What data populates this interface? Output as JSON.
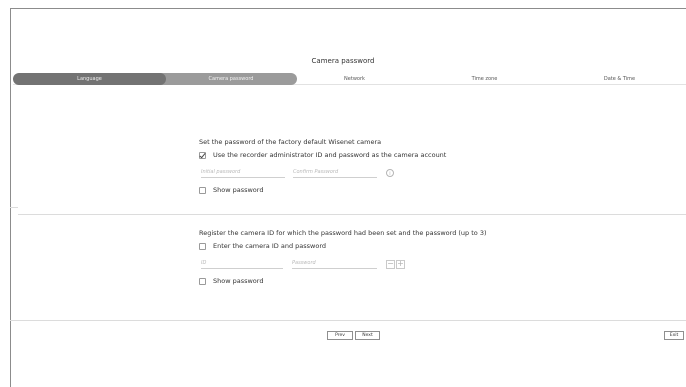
{
  "header": {
    "title": "Camera password"
  },
  "steps": [
    {
      "label": "Language",
      "state": "done"
    },
    {
      "label": "Camera password",
      "state": "active"
    },
    {
      "label": "Network",
      "state": "pending"
    },
    {
      "label": "Time zone",
      "state": "pending"
    },
    {
      "label": "Date & Time",
      "state": "pending"
    }
  ],
  "section1": {
    "heading": "Set the password of the factory default Wisenet camera",
    "use_admin_checkbox": {
      "label": "Use the recorder administrator ID and password as the camera account",
      "checked": true
    },
    "initial_password_placeholder": "Initial password",
    "confirm_password_placeholder": "Confirm Password",
    "info_icon": "info-icon",
    "show_password": {
      "label": "Show password",
      "checked": false
    }
  },
  "section2": {
    "heading": "Register the camera ID for which the password had been set and the password (up to 3)",
    "enter_id_checkbox": {
      "label": "Enter the camera ID and password",
      "checked": false
    },
    "id_placeholder": "ID",
    "password_placeholder": "Password",
    "minus_glyph": "−",
    "plus_glyph": "+",
    "show_password": {
      "label": "Show password",
      "checked": false
    }
  },
  "footer": {
    "prev_label": "Prev",
    "next_label": "Next",
    "exit_label": "Exit"
  },
  "colors": {
    "step_done": "#737373",
    "step_active": "#9b9b9b"
  }
}
